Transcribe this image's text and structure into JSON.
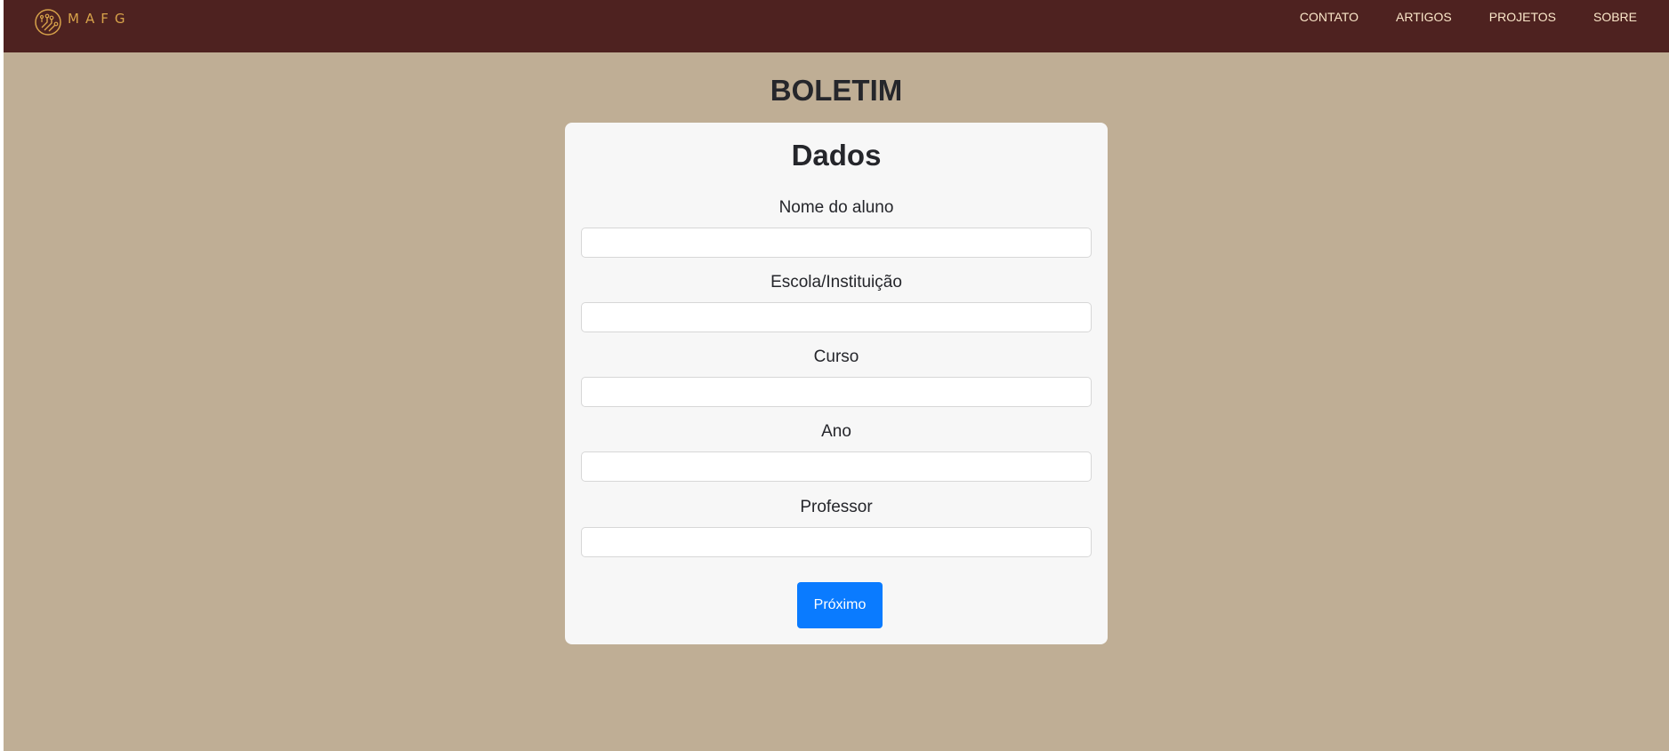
{
  "brand": {
    "name": "MAFG",
    "icon": "circuit-logo-icon"
  },
  "nav": {
    "items": [
      {
        "label": "CONTATO"
      },
      {
        "label": "ARTIGOS"
      },
      {
        "label": "PROJETOS"
      },
      {
        "label": "SOBRE"
      }
    ]
  },
  "page": {
    "title": "BOLETIM"
  },
  "form": {
    "title": "Dados",
    "fields": [
      {
        "label": "Nome do aluno",
        "value": ""
      },
      {
        "label": "Escola/Instituição",
        "value": ""
      },
      {
        "label": "Curso",
        "value": ""
      },
      {
        "label": "Ano",
        "value": ""
      },
      {
        "label": "Professor",
        "value": ""
      }
    ],
    "next_label": "Próximo"
  },
  "colors": {
    "navbar": "#4e2220",
    "background": "#bfae95",
    "card": "#f7f7f7",
    "accent": "#0a7bff",
    "logo": "#d7a24a"
  }
}
